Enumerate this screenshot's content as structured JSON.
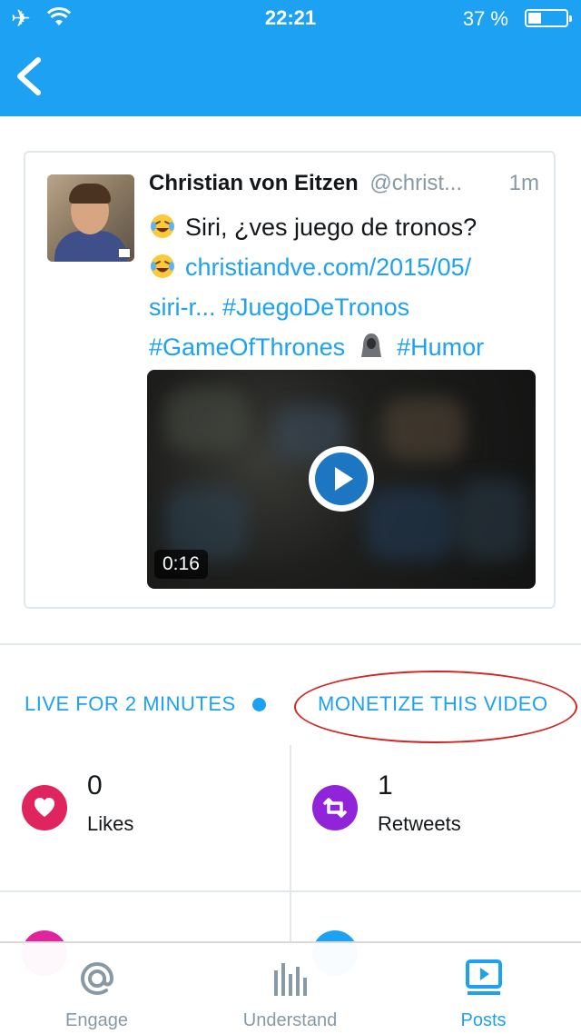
{
  "status_bar": {
    "time": "22:21",
    "battery": "37 %"
  },
  "tweet": {
    "author_name": "Christian von Eitzen",
    "handle": "@christ...",
    "time_ago": "1m",
    "line1": "Siri, ¿ves juego de tronos?",
    "link": "christiandve.com/2015/05/",
    "link_cont": "siri-r...",
    "hashtag1": "#JuegoDeTronos",
    "hashtag2": "#GameOfThrones",
    "hashtag3": "#Humor",
    "video_duration": "0:16"
  },
  "actions": {
    "live_label": "LIVE FOR 2 MINUTES",
    "monetize_label": "MONETIZE THIS VIDEO"
  },
  "stats": [
    {
      "value": "0",
      "label": "Likes",
      "color": "#e0245e"
    },
    {
      "value": "1",
      "label": "Retweets",
      "color": "#9124d8"
    }
  ],
  "tabs": [
    {
      "label": "Engage",
      "icon": "at-icon",
      "active": false
    },
    {
      "label": "Understand",
      "icon": "bar-chart-icon",
      "active": false
    },
    {
      "label": "Posts",
      "icon": "video-posts-icon",
      "active": true
    }
  ],
  "colors": {
    "accent": "#1da1f2",
    "likes": "#e0245e",
    "retweets": "#9124d8",
    "annotation": "#d32424"
  }
}
